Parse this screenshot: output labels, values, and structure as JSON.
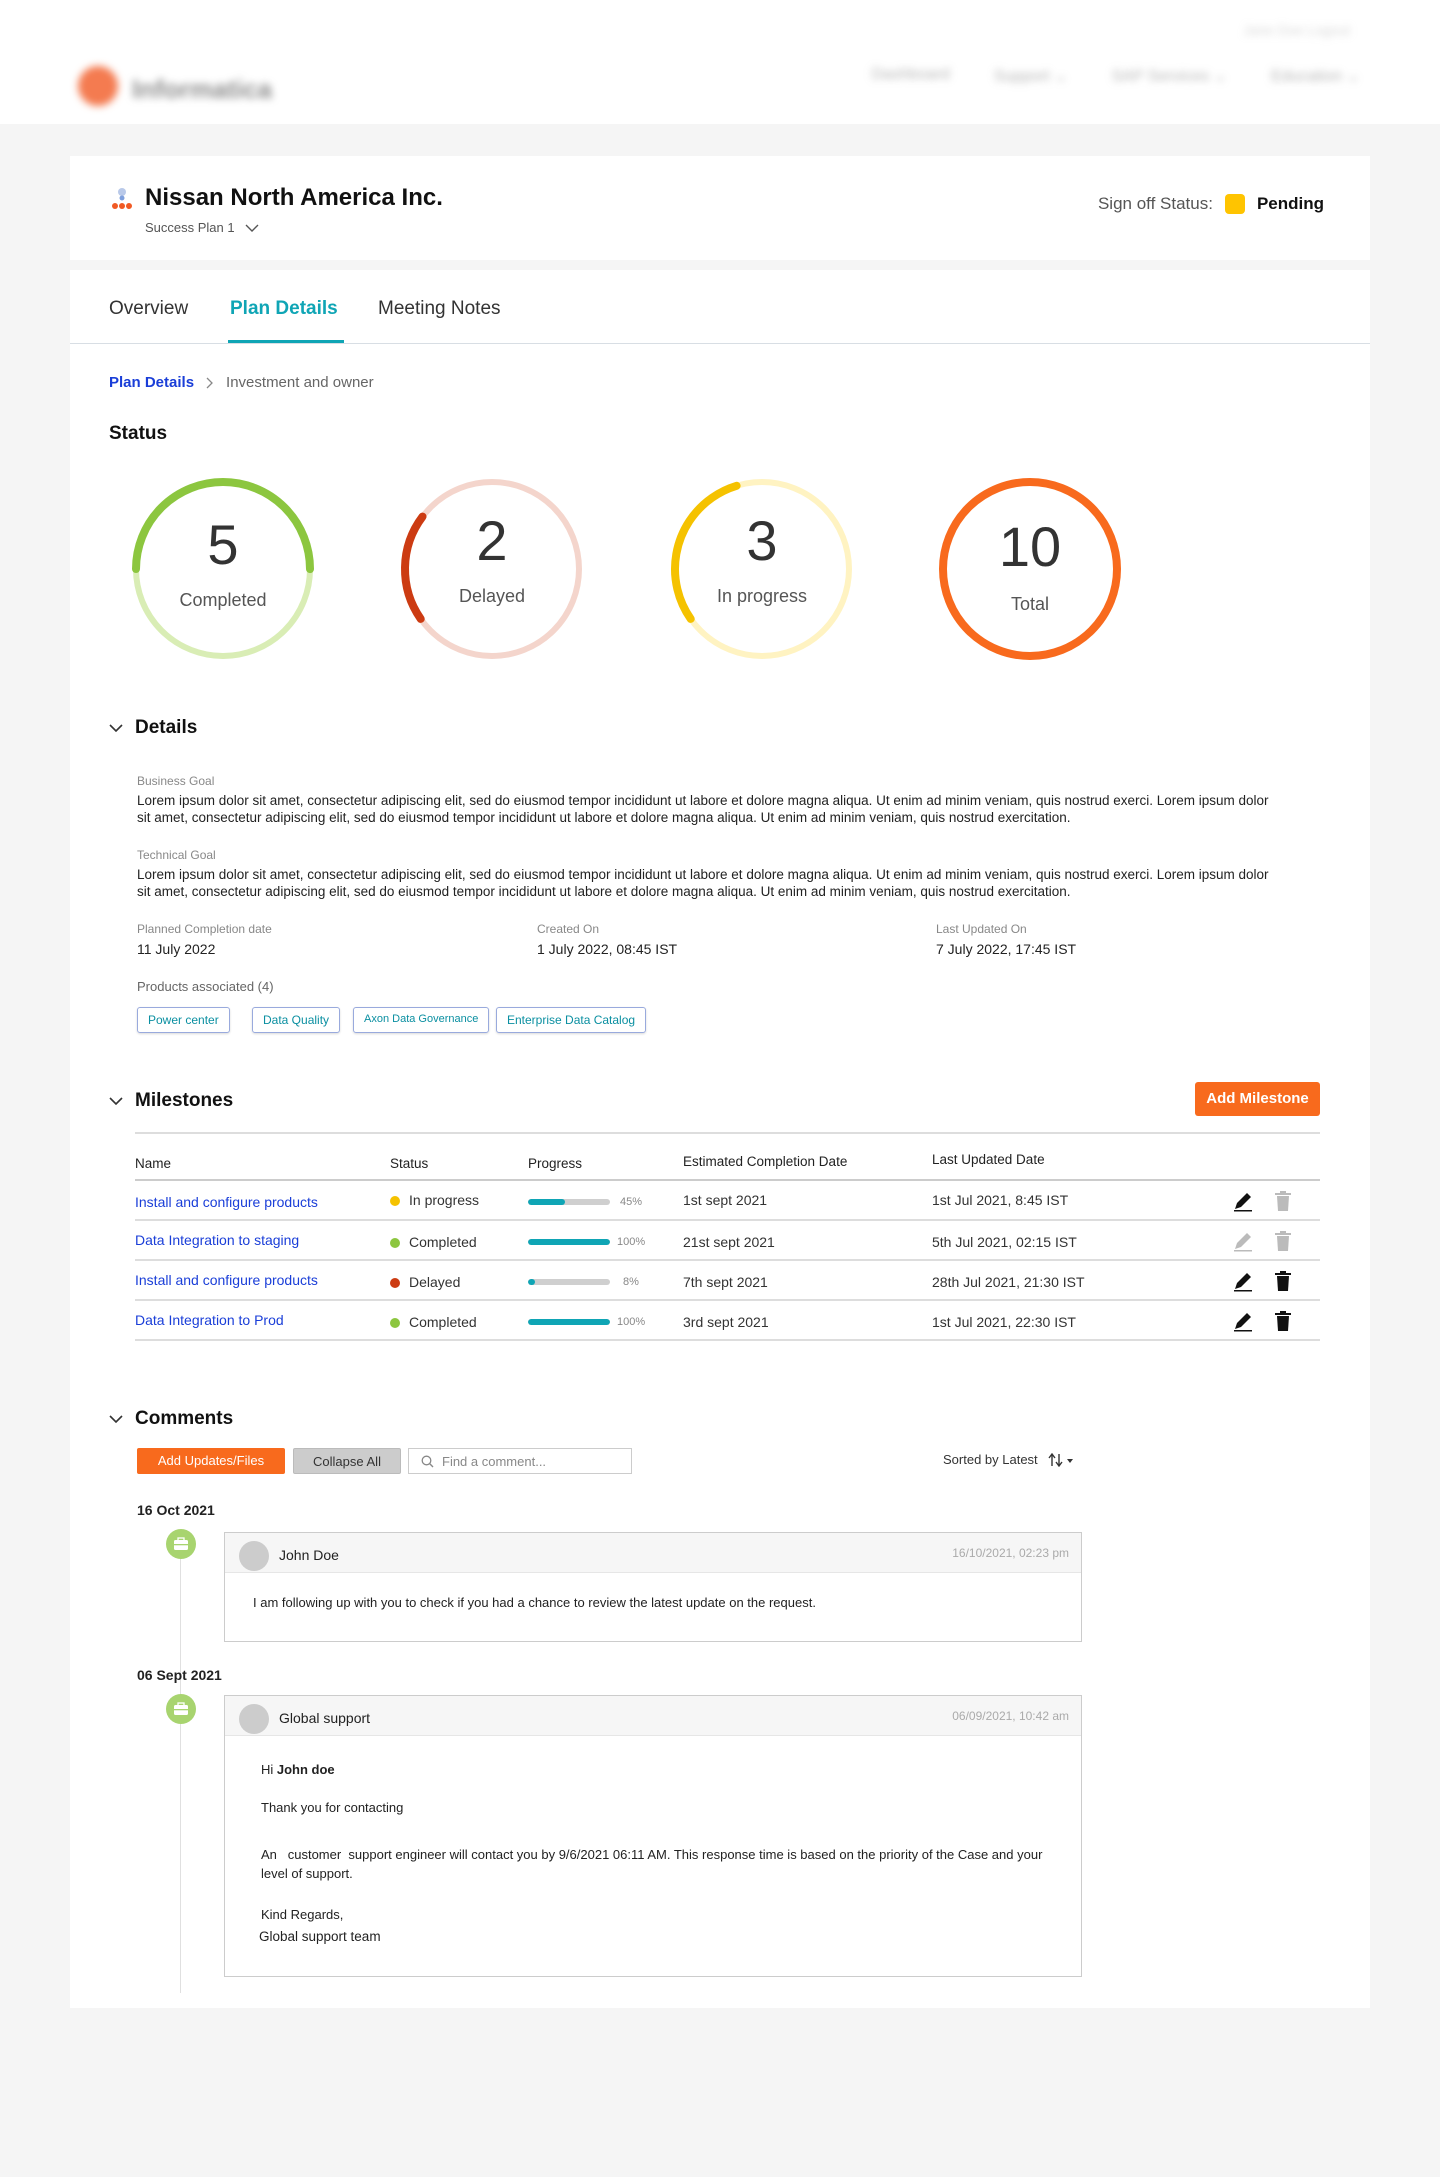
{
  "topnav": {
    "logo": "Informatica",
    "items": [
      "Dashboard",
      "Support ⌄",
      "SAP Services ⌄",
      "Education ⌄"
    ],
    "util": "Jane Doe   Logout"
  },
  "header": {
    "org_name": "Nissan North America Inc.",
    "plan_name": "Success Plan 1",
    "signoff_label": "Sign off Status:",
    "signoff_value": "Pending",
    "signoff_color": "#ffc400"
  },
  "tabs": [
    "Overview",
    "Plan Details",
    "Meeting Notes"
  ],
  "active_tab": "Plan Details",
  "breadcrumb": {
    "link": "Plan Details",
    "current": "Investment and owner"
  },
  "status": {
    "title": "Status",
    "rings": [
      {
        "value": "5",
        "label": "Completed",
        "fraction": 0.5,
        "track": "#d9edb5",
        "color": "#8cc63f"
      },
      {
        "value": "2",
        "label": "Delayed",
        "fraction": 0.2,
        "track": "#f4d5cc",
        "color": "#cc3b12"
      },
      {
        "value": "3",
        "label": "In progress",
        "fraction": 0.3,
        "track": "#fff3c2",
        "color": "#f5c200"
      },
      {
        "value": "10",
        "label": "Total",
        "fraction": 1.0,
        "track": "#fbd0b5",
        "color": "#f86a1d"
      }
    ]
  },
  "details": {
    "title": "Details",
    "business_goal_label": "Business Goal",
    "business_goal": "Lorem ipsum dolor sit amet, consectetur adipiscing elit, sed do eiusmod tempor incididunt ut labore et dolore magna aliqua. Ut enim ad minim veniam, quis nostrud exerci. Lorem ipsum dolor sit amet, consectetur adipiscing elit, sed do eiusmod tempor incididunt ut labore et dolore magna aliqua. Ut enim ad minim veniam, quis nostrud exercitation.",
    "technical_goal_label": "Technical Goal",
    "technical_goal": "Lorem ipsum dolor sit amet, consectetur adipiscing elit, sed do eiusmod tempor incididunt ut labore et dolore magna aliqua. Ut enim ad minim veniam, quis nostrud exerci. Lorem ipsum dolor sit amet, consectetur adipiscing elit, sed do eiusmod tempor incididunt ut labore et dolore magna aliqua. Ut enim ad minim veniam, quis nostrud exercitation.",
    "planned_label": "Planned Completion date",
    "planned": "11 July 2022",
    "created_label": "Created On",
    "created": "1 July 2022, 08:45 IST",
    "updated_label": "Last Updated On",
    "updated": "7 July 2022, 17:45 IST",
    "products_label": "Products associated (4)",
    "products": [
      "Power center",
      "Data Quality",
      "Axon Data Governance",
      "Enterprise Data Catalog"
    ]
  },
  "milestones": {
    "title": "Milestones",
    "add_label": "Add Milestone",
    "headers": [
      "Name",
      "Status",
      "Progress",
      "Estimated Completion Date",
      "Last Updated Date"
    ],
    "rows": [
      {
        "name": "Install and configure products",
        "status": "In progress",
        "status_color": "#f5c200",
        "progress": 0.45,
        "pct": "45%",
        "est": "1st sept 2021",
        "updated": "1st Jul 2021, 8:45 IST",
        "edit_enabled": true,
        "delete_enabled": false
      },
      {
        "name": "Data Integration to staging",
        "status": "Completed",
        "status_color": "#8cc63f",
        "progress": 1.0,
        "pct": "100%",
        "est": "21st sept 2021",
        "updated": "5th Jul 2021, 02:15 IST",
        "edit_enabled": false,
        "delete_enabled": false
      },
      {
        "name": "Install and configure products",
        "status": "Delayed",
        "status_color": "#cc3b12",
        "progress": 0.08,
        "pct": "8%",
        "est": "7th sept 2021",
        "updated": "28th Jul 2021, 21:30 IST",
        "edit_enabled": true,
        "delete_enabled": true
      },
      {
        "name": "Data Integration to Prod",
        "status": "Completed",
        "status_color": "#8cc63f",
        "progress": 1.0,
        "pct": "100%",
        "est": "3rd sept 2021",
        "updated": "1st Jul 2021, 22:30 IST",
        "edit_enabled": true,
        "delete_enabled": true
      }
    ]
  },
  "comments": {
    "title": "Comments",
    "add_label": "Add Updates/Files",
    "collapse_label": "Collapse All",
    "search_placeholder": "Find a comment...",
    "sort_label": "Sorted by Latest",
    "groups": [
      {
        "date": "16 Oct 2021",
        "author": "John Doe",
        "time": "16/10/2021, 02:23 pm",
        "body": "I am following up with you to check if you had a chance to review the latest update on the request."
      },
      {
        "date": "06 Sept 2021",
        "author": "Global support",
        "time": "06/09/2021, 10:42 am",
        "greeting": "Hi ",
        "greeting_name": "John doe",
        "line1": "Thank you for contacting",
        "line2": "An   customer  support engineer will contact you by 9/6/2021 06:11 AM. This response time is based on the priority of the Case and your level of support.",
        "sign1": "Kind Regards,",
        "sign2": "Global support team"
      }
    ]
  }
}
